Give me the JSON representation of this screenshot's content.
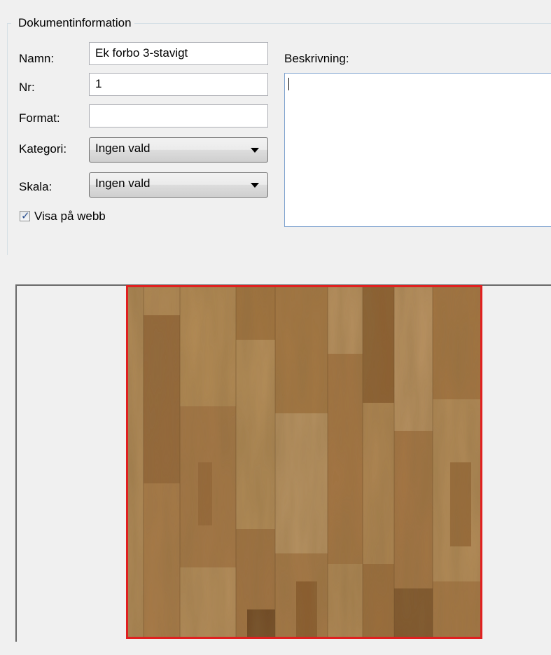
{
  "group": {
    "title": "Dokumentinformation"
  },
  "fields": {
    "name_label": "Namn:",
    "name_value": "Ek forbo 3-stavigt",
    "nr_label": "Nr:",
    "nr_value": "1",
    "format_label": "Format:",
    "format_value": "",
    "category_label": "Kategori:",
    "category_value": "Ingen vald",
    "scale_label": "Skala:",
    "scale_value": "Ingen vald",
    "show_web_label": "Visa på webb",
    "show_web_checked": true,
    "description_label": "Beskrivning:",
    "description_value": ""
  },
  "preview": {
    "image": "oak-three-strip-parquet-texture",
    "border_color": "#e02020"
  }
}
